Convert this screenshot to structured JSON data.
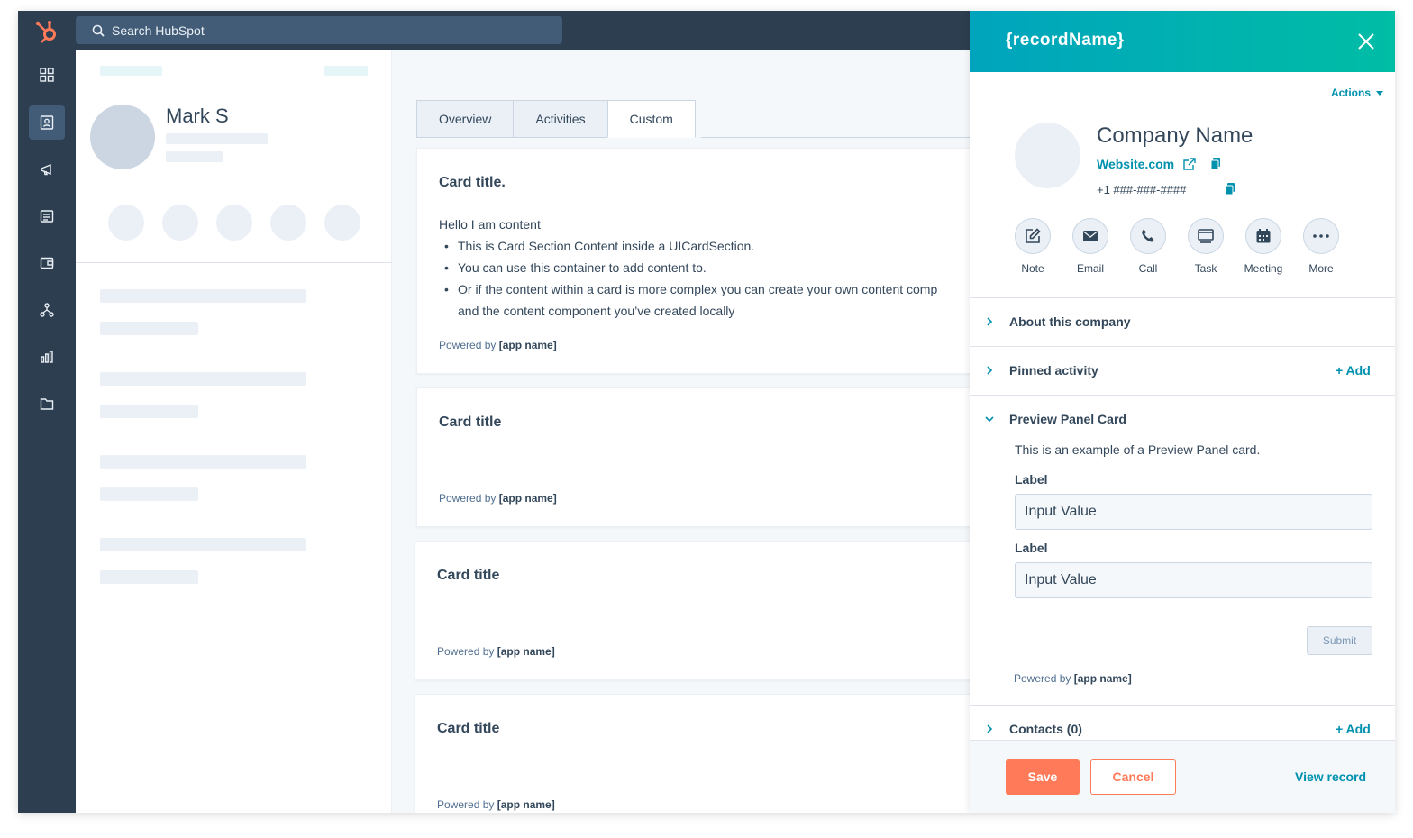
{
  "app": {
    "brand_color": "#ff7a59",
    "accent_color": "#0091ae",
    "nav_color": "#2d3e50"
  },
  "search": {
    "placeholder": "Search HubSpot"
  },
  "rail": {
    "icons": [
      "grid-icon",
      "contacts-icon",
      "megaphone-icon",
      "documents-icon",
      "commerce-icon",
      "automation-icon",
      "reports-icon",
      "folder-icon"
    ]
  },
  "profile": {
    "name": "Mark S"
  },
  "tabs": [
    {
      "label": "Overview"
    },
    {
      "label": "Activities"
    },
    {
      "label": "Custom"
    }
  ],
  "cards": [
    {
      "title": "Card title.",
      "intro": "Hello I am content",
      "bullets": [
        "This is Card Section Content inside a UICardSection.",
        "You can use this container to add content to.",
        "Or if the content within a card is more complex you can create your own content comp",
        "and the content component you’ve created locally"
      ],
      "powered_prefix": "Powered by",
      "app_name": "[app name]"
    },
    {
      "title": "Card title",
      "powered_prefix": "Powered by",
      "app_name": "[app name]"
    },
    {
      "title": "Card title",
      "powered_prefix": "Powered by",
      "app_name": "[app name]"
    },
    {
      "title": "Card title",
      "powered_prefix": "Powered by",
      "app_name": "[app name]"
    }
  ],
  "panel": {
    "title": "{recordName}",
    "actions_label": "Actions",
    "company_name": "Company Name",
    "website": "Website.com",
    "phone": "+1 ###-###-####",
    "quick_actions": [
      {
        "label": "Note",
        "icon": "note-icon"
      },
      {
        "label": "Email",
        "icon": "email-icon"
      },
      {
        "label": "Call",
        "icon": "call-icon"
      },
      {
        "label": "Task",
        "icon": "task-icon"
      },
      {
        "label": "Meeting",
        "icon": "meeting-icon"
      },
      {
        "label": "More",
        "icon": "more-icon"
      }
    ],
    "sections": {
      "about": {
        "title": "About this company"
      },
      "pinned": {
        "title": "Pinned activity",
        "add_label": "+ Add"
      },
      "preview": {
        "title": "Preview Panel Card",
        "text": "This is an example of a Preview Panel card.",
        "field1_label": "Label",
        "field1_value": "Input Value",
        "field2_label": "Label",
        "field2_value": "Input Value",
        "submit_label": "Submit",
        "powered_prefix": "Powered by",
        "app_name": "[app name]"
      },
      "contacts": {
        "title": "Contacts (0)",
        "add_label": "+ Add"
      }
    },
    "footer": {
      "save_label": "Save",
      "cancel_label": "Cancel",
      "view_record_label": "View record"
    }
  }
}
